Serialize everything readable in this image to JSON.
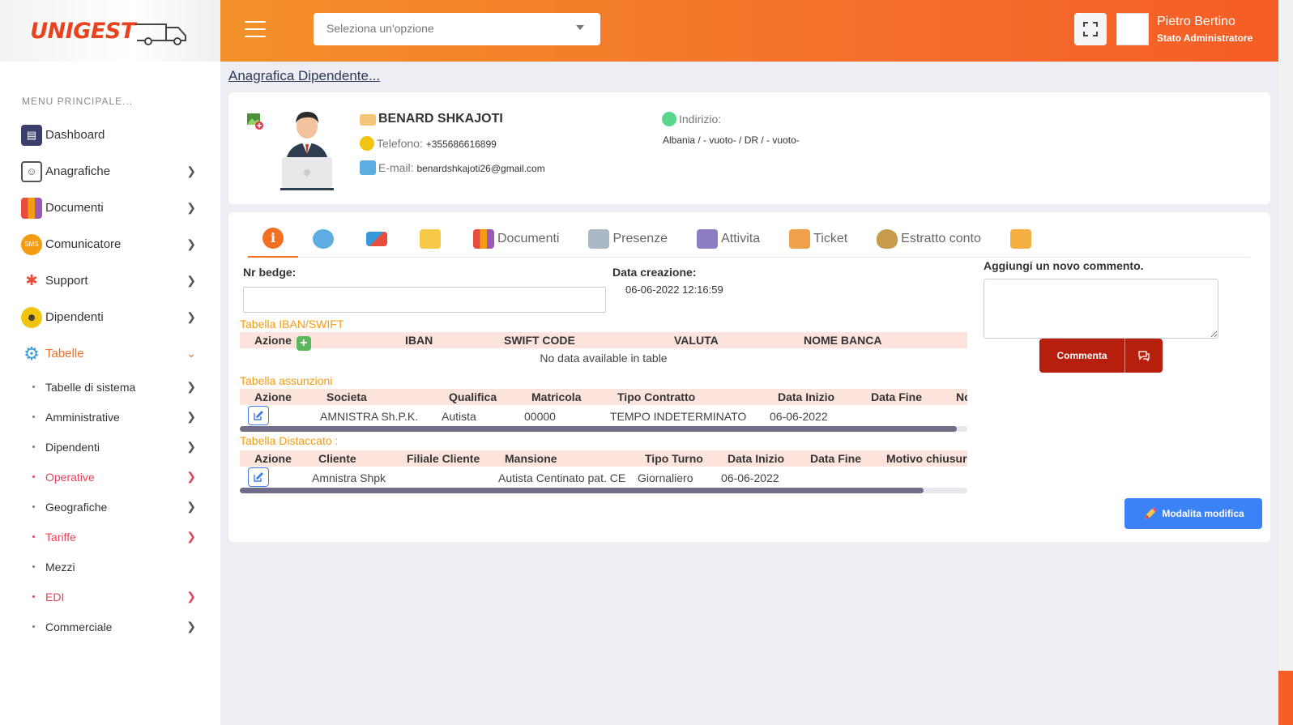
{
  "app": {
    "logo_text": "UNIGEST"
  },
  "sidebar": {
    "menu_title": "MENU PRINCIPALE...",
    "items": [
      {
        "label": "Dashboard",
        "icon": "dashboard-icon",
        "color": "#3b3f6b",
        "has_chevron": false
      },
      {
        "label": "Anagrafiche",
        "icon": "contacts-book-icon",
        "color": "#5a5a5a",
        "has_chevron": true
      },
      {
        "label": "Documenti",
        "icon": "binders-icon",
        "color": "#e74c3c",
        "has_chevron": true
      },
      {
        "label": "Comunicatore",
        "icon": "sms-bubble-icon",
        "color": "#f39c12",
        "has_chevron": true
      },
      {
        "label": "Support",
        "icon": "support-people-icon",
        "color": "#e74c3c",
        "has_chevron": true
      },
      {
        "label": "Dipendenti",
        "icon": "employees-icon",
        "color": "#f1c40f",
        "has_chevron": true
      },
      {
        "label": "Tabelle",
        "icon": "gear-icon",
        "color": "#3498db",
        "has_chevron": true,
        "active": true
      }
    ],
    "subitems": [
      {
        "label": "Tabelle di sistema",
        "red": false,
        "chevron": true
      },
      {
        "label": "Amministrative",
        "red": false,
        "chevron": true
      },
      {
        "label": "Dipendenti",
        "red": false,
        "chevron": true
      },
      {
        "label": "Operative",
        "red": true,
        "chevron": true
      },
      {
        "label": "Geografiche",
        "red": false,
        "chevron": true
      },
      {
        "label": "Tariffe",
        "red": true,
        "chevron": true
      },
      {
        "label": "Mezzi",
        "red": false,
        "chevron": false
      },
      {
        "label": "EDI",
        "red": true,
        "chevron": true
      },
      {
        "label": "Commerciale",
        "red": false,
        "chevron": true
      }
    ]
  },
  "header": {
    "select_placeholder": "Seleziona un'opzione",
    "user_name": "Pietro Bertino",
    "user_role": "Stato Administratore"
  },
  "page": {
    "breadcrumb": "Anagrafica Dipendente..."
  },
  "employee": {
    "name": "BENARD SHKAJOTI",
    "phone_label": "Telefono:",
    "phone": "+355686616899",
    "email_label": "E-mail:",
    "email": "benardshkajoti26@gmail.com",
    "address_label": "Indirizio:",
    "address": "Albania / - vuoto- / DR / - vuoto-"
  },
  "tabs": [
    {
      "label": "",
      "icon": "info-icon",
      "active": true
    },
    {
      "label": "",
      "icon": "chat-bubbles-icon"
    },
    {
      "label": "",
      "icon": "mail-icon"
    },
    {
      "label": "",
      "icon": "sticky-note-icon"
    },
    {
      "label": "Documenti",
      "icon": "binders-icon"
    },
    {
      "label": "Presenze",
      "icon": "calendar-clock-icon"
    },
    {
      "label": "Attivita",
      "icon": "tasks-icon"
    },
    {
      "label": "Ticket",
      "icon": "ticket-icon"
    },
    {
      "label": "Estratto conto",
      "icon": "money-bag-icon"
    },
    {
      "label": "",
      "icon": "sms-envelope-icon"
    }
  ],
  "details": {
    "badge_label": "Nr bedge:",
    "badge_value": "",
    "created_label": "Data creazione:",
    "created_value": "06-06-2022 12:16:59"
  },
  "iban_table": {
    "title": "Tabella IBAN/SWIFT",
    "headers": [
      "Azione",
      "IBAN",
      "SWIFT CODE",
      "VALUTA",
      "NOME BANCA"
    ],
    "empty": "No data available in table"
  },
  "assunzioni_table": {
    "title": "Tabella assunzioni",
    "headers": [
      "Azione",
      "Societa",
      "Qualifica",
      "Matricola",
      "Tipo Contratto",
      "Data Inizio",
      "Data Fine",
      "No"
    ],
    "rows": [
      [
        "",
        "AMNISTRA Sh.P.K.",
        "Autista",
        "00000",
        "TEMPO INDETERMINATO",
        "06-06-2022",
        "",
        ""
      ]
    ],
    "scroll_fraction": 0.985
  },
  "distaccato_table": {
    "title": "Tabella Distaccato :",
    "headers": [
      "Azione",
      "Cliente",
      "Filiale Cliente",
      "Mansione",
      "Tipo Turno",
      "Data Inizio",
      "Data Fine",
      "Motivo chiusura"
    ],
    "rows": [
      [
        "",
        "Amnistra Shpk",
        "",
        "Autista Centinato pat. CE",
        "Giornaliero",
        "06-06-2022",
        "",
        ""
      ]
    ],
    "scroll_fraction": 0.94
  },
  "comment": {
    "label": "Aggiungi un novo commento.",
    "button": "Commenta"
  },
  "edit_button": "Modalita modifica",
  "colors": {
    "accent": "#f36f22",
    "header_start": "#f39029",
    "header_end": "#f55d27",
    "table_header": "#fce4dc",
    "section_title": "#f39c12",
    "comment_button": "#b61e0d",
    "edit_button": "#3b82f6"
  }
}
